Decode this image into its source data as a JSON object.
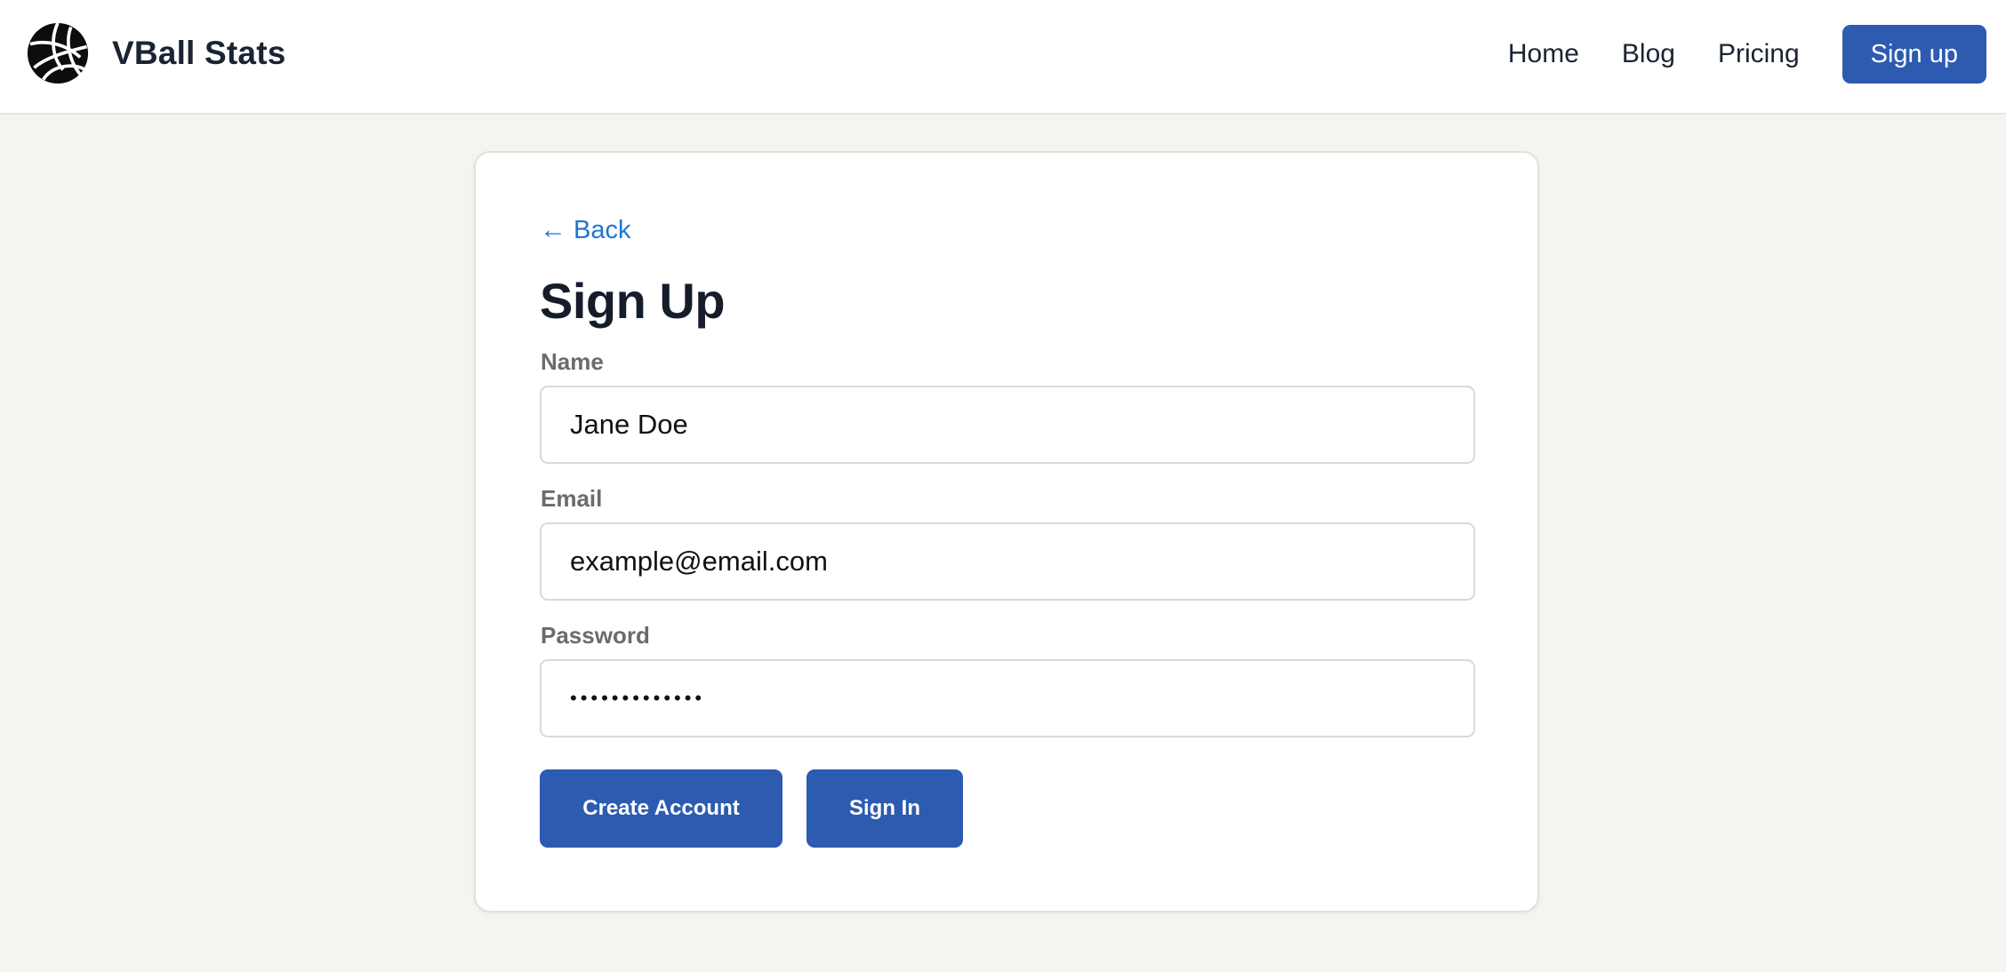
{
  "brand": {
    "name": "VBall Stats",
    "logo_icon": "volleyball-icon"
  },
  "nav": {
    "links": [
      "Home",
      "Blog",
      "Pricing"
    ],
    "signup_label": "Sign up"
  },
  "form": {
    "back_label": "Back",
    "back_icon": "arrow-left-icon",
    "title": "Sign Up",
    "fields": [
      {
        "label": "Name",
        "value": "Jane Doe",
        "type": "text"
      },
      {
        "label": "Email",
        "value": "example@email.com",
        "type": "email"
      },
      {
        "label": "Password",
        "value": "•••••••••••••",
        "type": "password"
      }
    ],
    "create_label": "Create Account",
    "signin_label": "Sign In"
  },
  "colors": {
    "accent": "#2d5bb0",
    "link": "#1f76d2",
    "page_bg": "#f5f4f0"
  }
}
